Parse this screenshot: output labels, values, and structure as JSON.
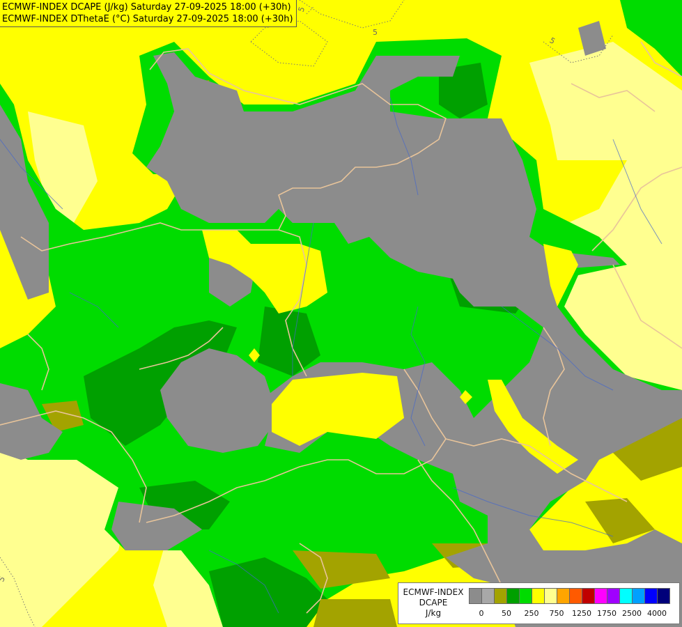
{
  "title": {
    "line1": "ECMWF-INDEX DCAPE (J/kg) Saturday 27-09-2025 18:00 (+30h)",
    "line2": "ECMWF-INDEX DThetaE (°C) Saturday 27-09-2025 18:00 (+30h)"
  },
  "legend": {
    "model": "ECMWF-INDEX",
    "param": "DCAPE",
    "unit": "J/kg",
    "colors": [
      "#8c8c8c",
      "#a8a8a8",
      "#a3a300",
      "#00a000",
      "#00dc00",
      "#ffff00",
      "#ffff90",
      "#ffa500",
      "#ff5a00",
      "#c00000",
      "#ff00ff",
      "#a000ff",
      "#00ffff",
      "#00a0ff",
      "#0000ff",
      "#00007a"
    ],
    "ticks": [
      "0",
      "50",
      "250",
      "750",
      "1250",
      "1750",
      "2500",
      "4000"
    ]
  },
  "contour_labels": [
    "5",
    "5",
    "5",
    "5"
  ],
  "palette": {
    "gray": "#8c8c8c",
    "olive": "#a3a300",
    "dark_green": "#00a000",
    "green": "#00dc00",
    "yellow": "#ffff00",
    "light_yellow": "#ffff90",
    "border": "#e8c49a",
    "river": "#4466cc"
  }
}
